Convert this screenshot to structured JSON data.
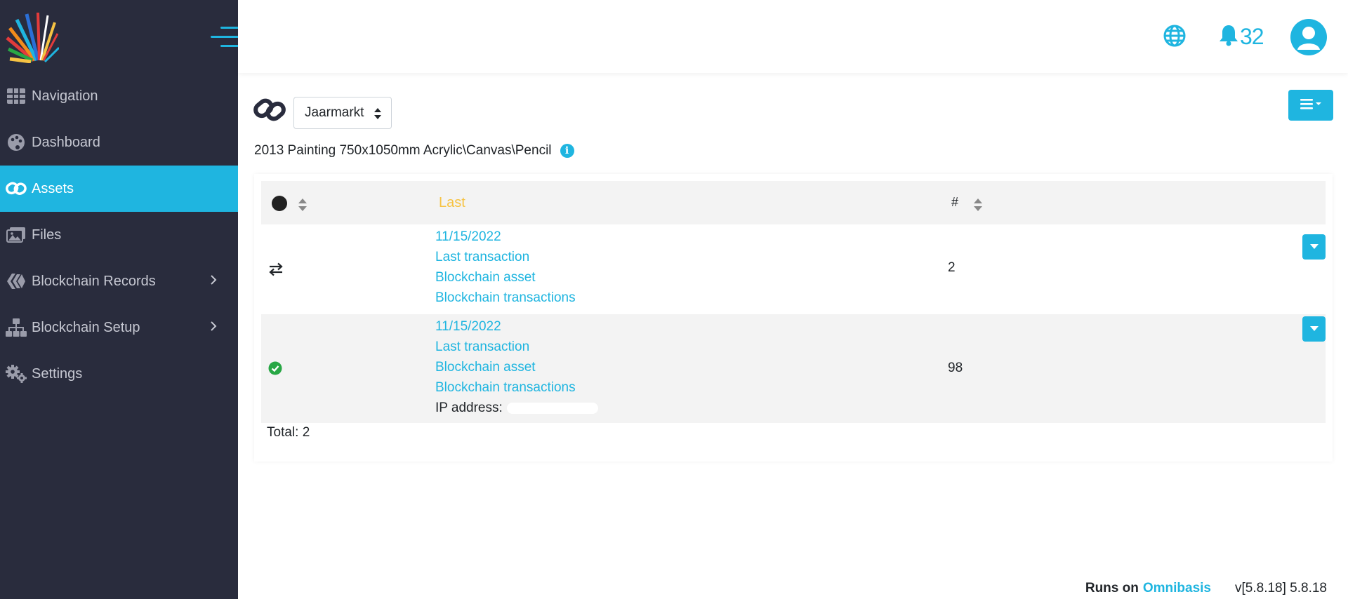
{
  "sidebar": {
    "items": [
      {
        "label": "Navigation",
        "icon": "grid-icon"
      },
      {
        "label": "Dashboard",
        "icon": "palette-icon"
      },
      {
        "label": "Assets",
        "icon": "link-icon",
        "active": true
      },
      {
        "label": "Files",
        "icon": "images-icon"
      },
      {
        "label": "Blockchain Records",
        "icon": "hive-icon",
        "expandable": true
      },
      {
        "label": "Blockchain Setup",
        "icon": "network-icon",
        "expandable": true
      },
      {
        "label": "Settings",
        "icon": "gears-icon"
      }
    ]
  },
  "topbar": {
    "notification_count": "32"
  },
  "main": {
    "selector_value": "Jaarmarkt",
    "description": "2013 Painting 750x1050mm Acrylic\\Canvas\\Pencil",
    "table": {
      "headers": {
        "status": "",
        "last": "Last",
        "count": "#"
      },
      "rows": [
        {
          "status_icon": "exchange-icon",
          "date": "11/15/2022",
          "links": [
            "Last transaction",
            "Blockchain asset",
            "Blockchain transactions"
          ],
          "count": "2"
        },
        {
          "status_icon": "check-circle-icon",
          "date": "11/15/2022",
          "links": [
            "Last transaction",
            "Blockchain asset",
            "Blockchain transactions"
          ],
          "ip_label": "IP address:",
          "count": "98"
        }
      ],
      "total": "Total: 2"
    }
  },
  "footer": {
    "runs_on": "Runs on",
    "brand": "Omnibasis",
    "version": "v[5.8.18] 5.8.18"
  },
  "colors": {
    "accent": "#1fb5e0",
    "sidebar_bg": "#292c3d",
    "header_highlight": "#f6c343",
    "success": "#28a745"
  }
}
